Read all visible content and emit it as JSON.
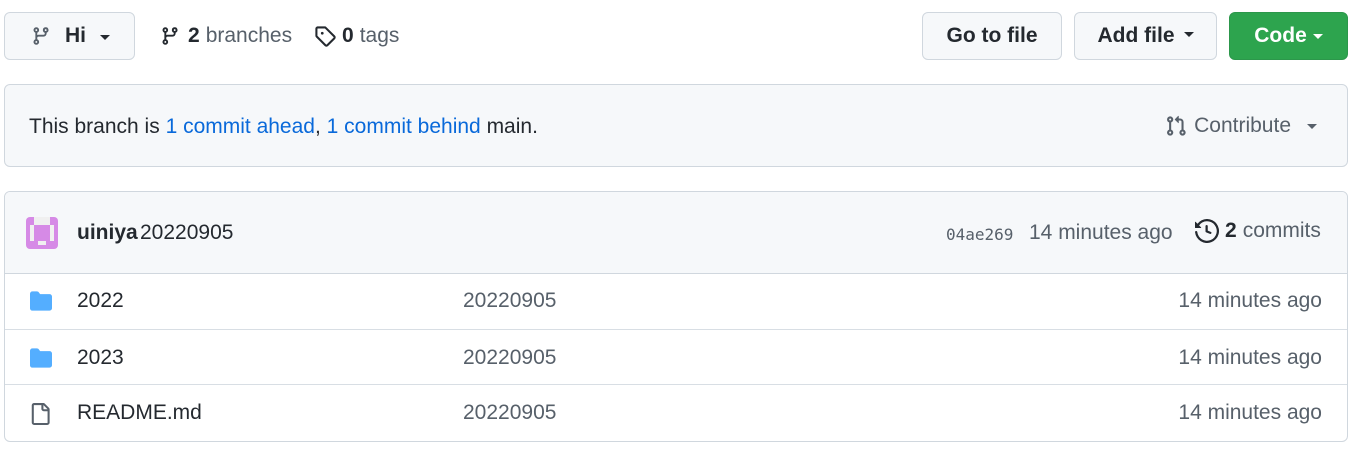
{
  "toolbar": {
    "branch_label": "Hi",
    "branches_count": "2",
    "branches_text": "branches",
    "tags_count": "0",
    "tags_text": "tags",
    "goto_file_label": "Go to file",
    "add_file_label": "Add file",
    "code_label": "Code"
  },
  "banner": {
    "prefix": "This branch is ",
    "ahead_link": "1 commit ahead",
    "separator": ", ",
    "behind_link": "1 commit behind",
    "suffix": " main.",
    "contribute_label": "Contribute"
  },
  "latest_commit": {
    "author": "uiniya",
    "message": "20220905",
    "sha": "04ae269",
    "time": "14 minutes ago",
    "commits_count": "2",
    "commits_text": "commits"
  },
  "files": [
    {
      "name": "2022",
      "type": "directory",
      "icon": "folder-icon",
      "message": "20220905",
      "time": "14 minutes ago"
    },
    {
      "name": "2023",
      "type": "directory",
      "icon": "folder-icon",
      "message": "20220905",
      "time": "14 minutes ago"
    },
    {
      "name": "README.md",
      "type": "file",
      "icon": "file-icon",
      "message": "20220905",
      "time": "14 minutes ago"
    }
  ],
  "colors": {
    "accent_link": "#0969da",
    "code_button": "#2da44e",
    "folder": "#54aeff",
    "avatar": "#d68ae6"
  }
}
